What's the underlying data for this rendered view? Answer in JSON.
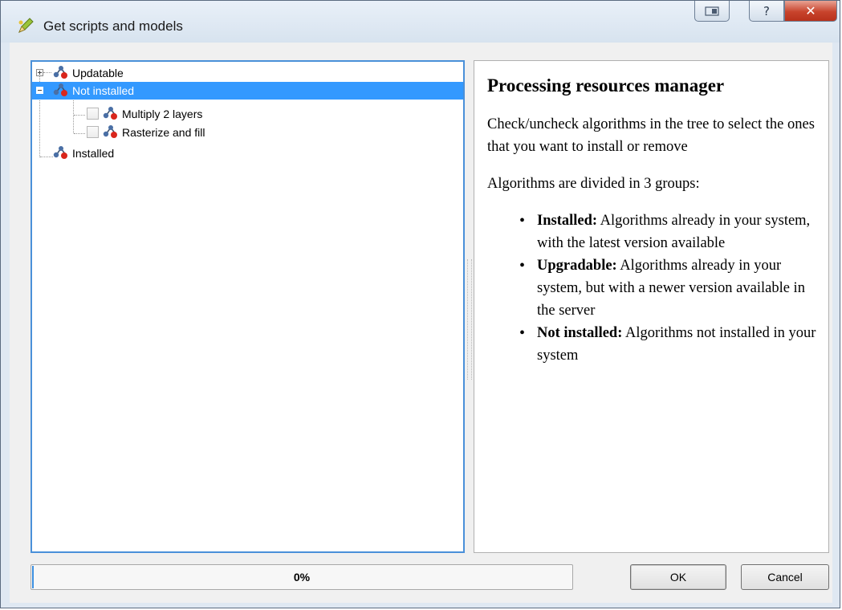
{
  "window": {
    "title": "Get scripts and models",
    "icon": "qgis-pencil-icon",
    "controls": [
      "restore-icon",
      "help-icon",
      "close-icon"
    ]
  },
  "tree": {
    "items": [
      {
        "label": "Updatable",
        "expander": "plus",
        "icon": "algorithm-icon",
        "selected": false
      },
      {
        "label": "Not installed",
        "expander": "minus",
        "icon": "algorithm-icon",
        "selected": true,
        "children": [
          {
            "label": "Multiply 2 layers",
            "checked": false,
            "icon": "algorithm-icon"
          },
          {
            "label": "Rasterize and fill",
            "checked": false,
            "icon": "algorithm-icon"
          }
        ]
      },
      {
        "label": "Installed",
        "expander": "none",
        "icon": "algorithm-icon",
        "selected": false
      }
    ]
  },
  "info": {
    "heading": "Processing resources manager",
    "paragraph1": "Check/uncheck algorithms in the tree to select the ones that you want to install or remove",
    "paragraph2": "Algorithms are divided in 3 groups:",
    "groups": [
      {
        "name": "Installed:",
        "text": " Algorithms already in your system, with the latest version available"
      },
      {
        "name": "Upgradable:",
        "text": " Algorithms already in your system, but with a newer version available in the server"
      },
      {
        "name": "Not installed:",
        "text": " Algorithms not installed in your system"
      }
    ]
  },
  "progress": {
    "value": 0,
    "label": "0%"
  },
  "buttons": {
    "ok": "OK",
    "cancel": "Cancel"
  },
  "colors": {
    "selection": "#3399ff",
    "focus_border": "#4a90d9",
    "progress_fill": "#3c8fe0",
    "close_button": "#c8432c"
  }
}
